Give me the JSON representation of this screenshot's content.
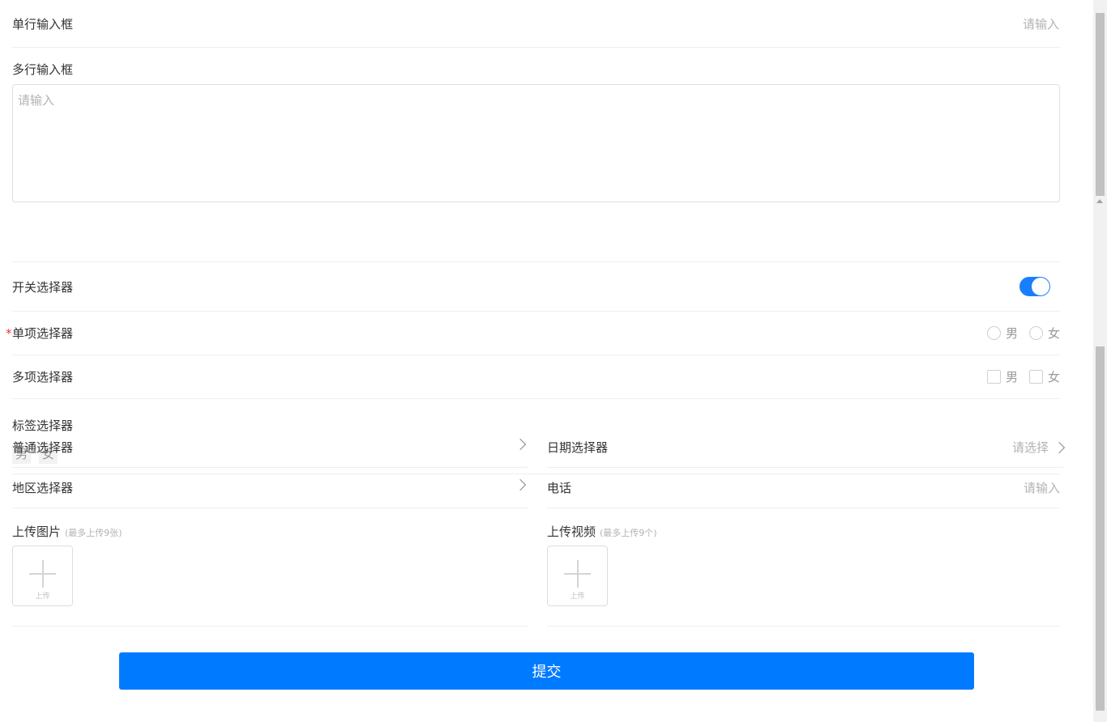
{
  "form": {
    "single_input": {
      "label": "单行输入框",
      "placeholder": "请输入"
    },
    "textarea": {
      "label": "多行输入框",
      "placeholder": "请输入"
    },
    "switch": {
      "label": "开关选择器",
      "checked": true
    },
    "radio": {
      "label": "单项选择器",
      "required_mark": "*",
      "options": [
        "男",
        "女"
      ]
    },
    "checkbox": {
      "label": "多项选择器",
      "options": [
        "男",
        "女"
      ]
    },
    "tags": {
      "label": "标签选择器",
      "options": [
        "男",
        "女"
      ]
    },
    "picker": {
      "label": "普通选择器"
    },
    "date_picker": {
      "label": "日期选择器",
      "placeholder": "请选择"
    },
    "region_picker": {
      "label": "地区选择器"
    },
    "phone": {
      "label": "电话",
      "placeholder": "请输入"
    },
    "upload_image": {
      "label": "上传图片",
      "hint": "(最多上传9张)",
      "button_text": "上传"
    },
    "upload_video": {
      "label": "上传视频",
      "hint": "(最多上传9个)",
      "button_text": "上传"
    },
    "submit_label": "提交"
  },
  "colors": {
    "primary": "#007aff",
    "switch_on": "#1a7fff",
    "required": "#e43d33"
  }
}
